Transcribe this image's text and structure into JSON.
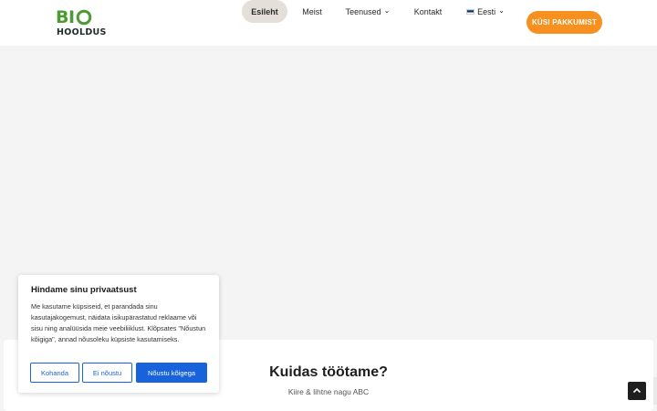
{
  "brand": {
    "logo_top": "BI",
    "logo_bottom": "HOOLDUS",
    "green": "#4b9b34",
    "dark": "#1e2a2a"
  },
  "nav": {
    "items": [
      {
        "label": "Esileht",
        "active": true
      },
      {
        "label": "Meist"
      },
      {
        "label": "Teenused",
        "has_dropdown": true
      },
      {
        "label": "Kontakt"
      },
      {
        "label": "Eesti",
        "has_dropdown": true,
        "icon": "estonia-flag-icon"
      }
    ],
    "cta_label": "KÜSI PAKKUMIST",
    "cta_color": "#f7901e"
  },
  "section": {
    "title": "Kuidas töötame?",
    "subtitle": "Kiire & lihtne nagu ABC"
  },
  "cookie_banner": {
    "title": "Hindame sinu privaatsust",
    "text": "Me kasutame küpsiseid, et parandada sinu kasutajakogemust, näidata isikupärastatud reklaame või sisu ning analüüsida meie veebiliiklust. Klõpsates \"Nõustun kõigiga\", annad nõusoleku küpsiste kasutamiseks.",
    "buttons": {
      "customize": "Kohanda",
      "reject": "Ei nõustu",
      "accept": "Nõustu kõigega"
    },
    "accent": "#1863dc"
  },
  "icons": {
    "scroll_top": "chevron-up-icon",
    "chevron": "chevron-down-icon"
  }
}
